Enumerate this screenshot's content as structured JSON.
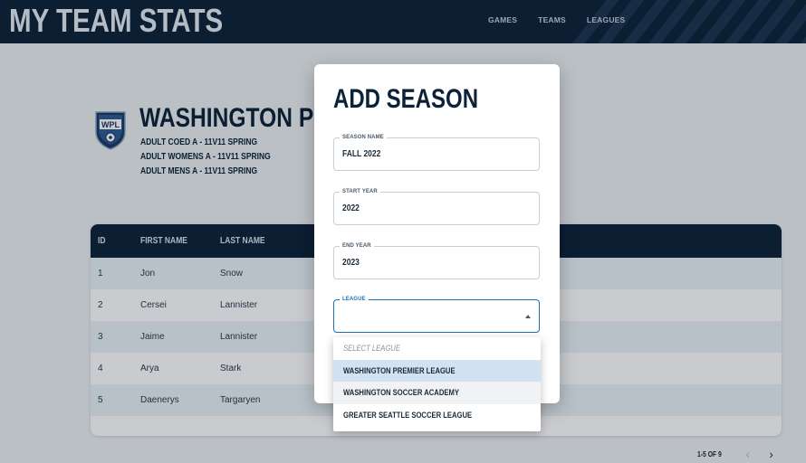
{
  "app": {
    "title": "MY TEAM STATS"
  },
  "nav": [
    {
      "label": "GAMES"
    },
    {
      "label": "TEAMS"
    },
    {
      "label": "LEAGUES"
    }
  ],
  "league": {
    "logo_text": "WPL",
    "name": "WASHINGTON PREMIER LEAGUE",
    "divisions": [
      "ADULT COED A - 11V11 SPRING",
      "ADULT WOMENS A - 11V11 SPRING",
      "ADULT MENS A - 11V11 SPRING"
    ]
  },
  "table": {
    "headers": [
      "ID",
      "FIRST NAME",
      "LAST NAME"
    ],
    "rows": [
      {
        "id": "1",
        "first": "Jon",
        "last": "Snow"
      },
      {
        "id": "2",
        "first": "Cersei",
        "last": "Lannister"
      },
      {
        "id": "3",
        "first": "Jaime",
        "last": "Lannister"
      },
      {
        "id": "4",
        "first": "Arya",
        "last": "Stark"
      },
      {
        "id": "5",
        "first": "Daenerys",
        "last": "Targaryen"
      }
    ]
  },
  "pagination": {
    "text": "1-5 OF 9",
    "prev": "‹",
    "next": "›"
  },
  "modal": {
    "title": "ADD SEASON",
    "fields": [
      {
        "label": "SEASON NAME",
        "value": "FALL 2022"
      },
      {
        "label": "START YEAR",
        "value": "2022"
      },
      {
        "label": "END YEAR",
        "value": "2023"
      },
      {
        "label": "LEAGUE",
        "value": ""
      }
    ],
    "league_options": [
      "SELECT LEAGUE",
      "WASHINGTON PREMIER LEAGUE",
      "WASHINGTON SOCCER ACADEMY",
      "GREATER SEATTLE SOCCER LEAGUE"
    ]
  },
  "colors": {
    "navy": "#0c2238",
    "accent": "#1f6fb5",
    "selected": "#d3e2f0"
  }
}
